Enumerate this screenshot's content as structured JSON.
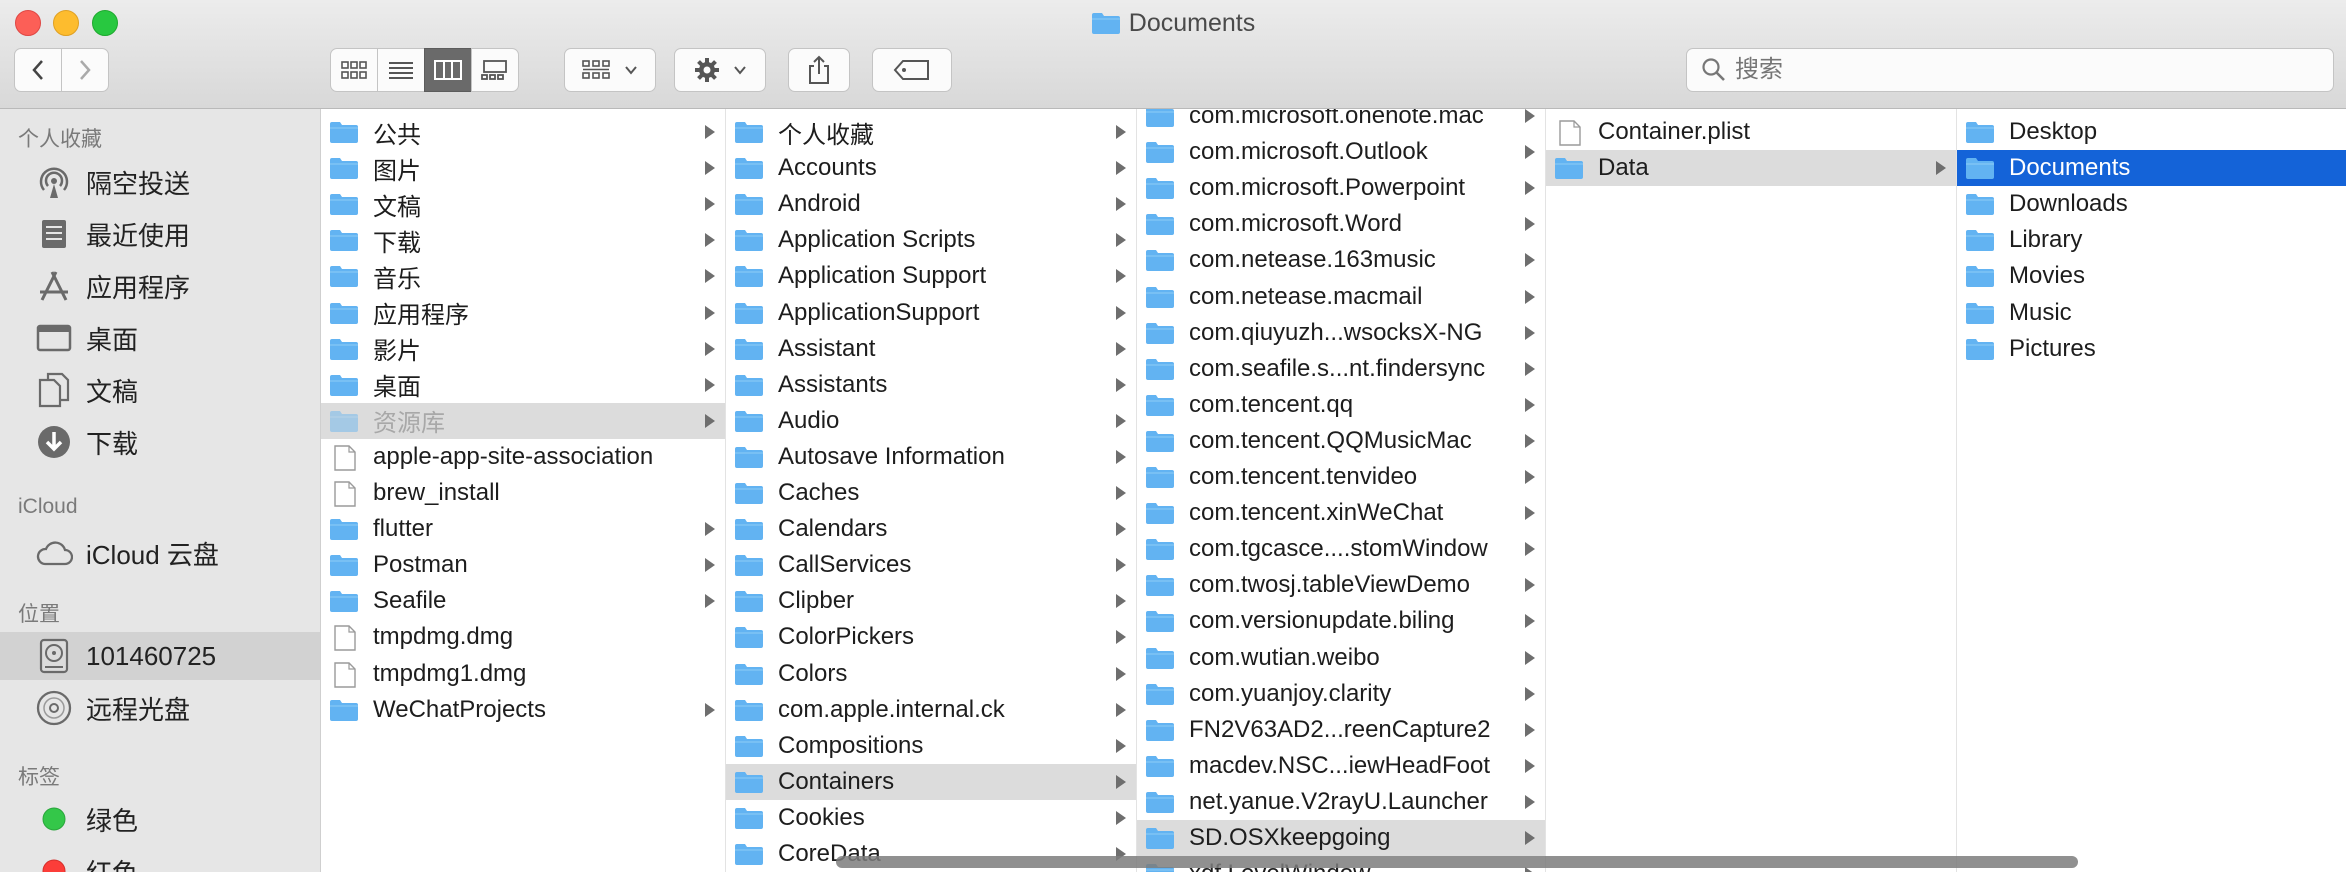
{
  "window": {
    "title": "Documents"
  },
  "toolbar": {
    "search_placeholder": "搜索"
  },
  "sidebar": {
    "sections": [
      {
        "heading": "个人收藏",
        "items": [
          {
            "label": "隔空投送",
            "icon": "airdrop-icon"
          },
          {
            "label": "最近使用",
            "icon": "recents-icon"
          },
          {
            "label": "应用程序",
            "icon": "applications-icon"
          },
          {
            "label": "桌面",
            "icon": "desktop-icon"
          },
          {
            "label": "文稿",
            "icon": "documents-icon"
          },
          {
            "label": "下载",
            "icon": "downloads-icon"
          }
        ]
      },
      {
        "heading": "iCloud",
        "items": [
          {
            "label": "iCloud 云盘",
            "icon": "cloud-icon"
          }
        ]
      },
      {
        "heading": "位置",
        "items": [
          {
            "label": "101460725",
            "icon": "harddisk-icon",
            "selected": true
          },
          {
            "label": "远程光盘",
            "icon": "disc-icon"
          }
        ]
      },
      {
        "heading": "标签",
        "items": [
          {
            "label": "绿色",
            "icon": "green-tag-icon",
            "color": "#34c749"
          },
          {
            "label": "红色",
            "icon": "red-tag-icon",
            "color": "#fc3d39"
          }
        ]
      }
    ]
  },
  "columns": [
    {
      "items": [
        {
          "label": "公共",
          "type": "folder",
          "arrow": true
        },
        {
          "label": "图片",
          "type": "folder",
          "arrow": true
        },
        {
          "label": "文稿",
          "type": "folder",
          "arrow": true
        },
        {
          "label": "下载",
          "type": "folder",
          "arrow": true
        },
        {
          "label": "音乐",
          "type": "folder",
          "arrow": true
        },
        {
          "label": "应用程序",
          "type": "folder",
          "arrow": true
        },
        {
          "label": "影片",
          "type": "folder",
          "arrow": true
        },
        {
          "label": "桌面",
          "type": "folder",
          "arrow": true
        },
        {
          "label": "资源库",
          "type": "folder",
          "arrow": true,
          "state": "gray",
          "dim": true
        },
        {
          "label": "apple-app-site-association",
          "type": "file",
          "arrow": false
        },
        {
          "label": "brew_install",
          "type": "file",
          "arrow": false
        },
        {
          "label": "flutter",
          "type": "folder",
          "arrow": true
        },
        {
          "label": "Postman",
          "type": "folder",
          "arrow": true
        },
        {
          "label": "Seafile",
          "type": "folder",
          "arrow": true
        },
        {
          "label": "tmpdmg.dmg",
          "type": "file",
          "arrow": false
        },
        {
          "label": "tmpdmg1.dmg",
          "type": "file",
          "arrow": false
        },
        {
          "label": "WeChatProjects",
          "type": "folder",
          "arrow": true
        }
      ]
    },
    {
      "items": [
        {
          "label": "个人收藏",
          "type": "folder",
          "arrow": true
        },
        {
          "label": "Accounts",
          "type": "folder",
          "arrow": true
        },
        {
          "label": "Android",
          "type": "folder",
          "arrow": true
        },
        {
          "label": "Application Scripts",
          "type": "folder",
          "arrow": true
        },
        {
          "label": "Application Support",
          "type": "folder",
          "arrow": true
        },
        {
          "label": "ApplicationSupport",
          "type": "folder",
          "arrow": true
        },
        {
          "label": "Assistant",
          "type": "folder",
          "arrow": true
        },
        {
          "label": "Assistants",
          "type": "folder",
          "arrow": true
        },
        {
          "label": "Audio",
          "type": "folder",
          "arrow": true
        },
        {
          "label": "Autosave Information",
          "type": "folder",
          "arrow": true
        },
        {
          "label": "Caches",
          "type": "folder",
          "arrow": true
        },
        {
          "label": "Calendars",
          "type": "folder",
          "arrow": true
        },
        {
          "label": "CallServices",
          "type": "folder",
          "arrow": true
        },
        {
          "label": "Clipber",
          "type": "folder",
          "arrow": true
        },
        {
          "label": "ColorPickers",
          "type": "folder",
          "arrow": true
        },
        {
          "label": "Colors",
          "type": "folder",
          "arrow": true
        },
        {
          "label": "com.apple.internal.ck",
          "type": "folder",
          "arrow": true
        },
        {
          "label": "Compositions",
          "type": "folder",
          "arrow": true
        },
        {
          "label": "Containers",
          "type": "folder",
          "arrow": true,
          "state": "gray"
        },
        {
          "label": "Cookies",
          "type": "folder",
          "arrow": true
        },
        {
          "label": "CoreData",
          "type": "folder",
          "arrow": true
        }
      ]
    },
    {
      "items": [
        {
          "label": "com.microsoft.onenote.mac",
          "type": "folder",
          "arrow": true
        },
        {
          "label": "com.microsoft.Outlook",
          "type": "folder",
          "arrow": true
        },
        {
          "label": "com.microsoft.Powerpoint",
          "type": "folder",
          "arrow": true
        },
        {
          "label": "com.microsoft.Word",
          "type": "folder",
          "arrow": true
        },
        {
          "label": "com.netease.163music",
          "type": "folder",
          "arrow": true
        },
        {
          "label": "com.netease.macmail",
          "type": "folder",
          "arrow": true
        },
        {
          "label": "com.qiuyuzh...wsocksX-NG",
          "type": "folder",
          "arrow": true
        },
        {
          "label": "com.seafile.s...nt.findersync",
          "type": "folder",
          "arrow": true
        },
        {
          "label": "com.tencent.qq",
          "type": "folder",
          "arrow": true
        },
        {
          "label": "com.tencent.QQMusicMac",
          "type": "folder",
          "arrow": true
        },
        {
          "label": "com.tencent.tenvideo",
          "type": "folder",
          "arrow": true
        },
        {
          "label": "com.tencent.xinWeChat",
          "type": "folder",
          "arrow": true
        },
        {
          "label": "com.tgcasce....stomWindow",
          "type": "folder",
          "arrow": true
        },
        {
          "label": "com.twosj.tableViewDemo",
          "type": "folder",
          "arrow": true
        },
        {
          "label": "com.versionupdate.biling",
          "type": "folder",
          "arrow": true
        },
        {
          "label": "com.wutian.weibo",
          "type": "folder",
          "arrow": true
        },
        {
          "label": "com.yuanjoy.clarity",
          "type": "folder",
          "arrow": true
        },
        {
          "label": "FN2V63AD2...reenCapture2",
          "type": "folder",
          "arrow": true
        },
        {
          "label": "macdev.NSC...iewHeadFoot",
          "type": "folder",
          "arrow": true
        },
        {
          "label": "net.yanue.V2rayU.Launcher",
          "type": "folder",
          "arrow": true
        },
        {
          "label": "SD.OSXkeepgoing",
          "type": "folder",
          "arrow": true,
          "state": "gray"
        },
        {
          "label": "xdf.LevelWindow",
          "type": "folder",
          "arrow": true
        }
      ]
    },
    {
      "items": [
        {
          "label": "Container.plist",
          "type": "file",
          "arrow": false
        },
        {
          "label": "Data",
          "type": "folder",
          "arrow": true,
          "state": "gray"
        }
      ]
    },
    {
      "items": [
        {
          "label": "Desktop",
          "type": "folder",
          "arrow": false
        },
        {
          "label": "Documents",
          "type": "folder",
          "arrow": false,
          "state": "blue"
        },
        {
          "label": "Downloads",
          "type": "folder",
          "arrow": false
        },
        {
          "label": "Library",
          "type": "folder",
          "arrow": false
        },
        {
          "label": "Movies",
          "type": "folder",
          "arrow": false
        },
        {
          "label": "Music",
          "type": "folder",
          "arrow": false
        },
        {
          "label": "Pictures",
          "type": "folder",
          "arrow": false
        }
      ]
    }
  ],
  "colors": {
    "folder": "#62b3f2",
    "selection": "#1463d8"
  }
}
